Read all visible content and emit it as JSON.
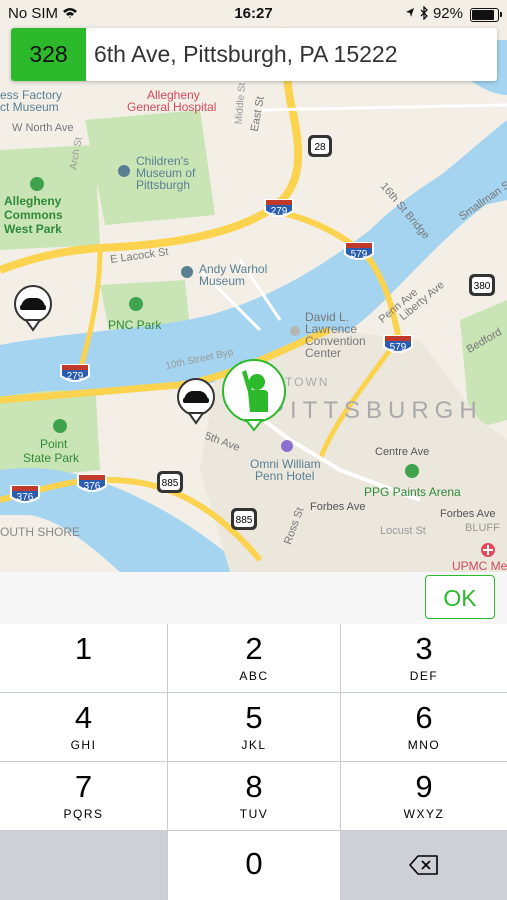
{
  "status_bar": {
    "carrier": "No SIM",
    "time": "16:27",
    "battery": "92%"
  },
  "address_bar": {
    "code": "328",
    "address": "6th Ave, Pittsburgh, PA 15222"
  },
  "map": {
    "labels": {
      "factory": "ess Factory",
      "factory2": "ct Museum",
      "allegheny_hospital": "Allegheny",
      "allegheny_hospital2": "General Hospital",
      "north_ave": "W North Ave",
      "childrens": "Children's",
      "childrens2": "Museum of",
      "childrens3": "Pittsburgh",
      "commons": "Allegheny",
      "commons2": "Commons",
      "commons3": "West Park",
      "lacock": "E Lacock St",
      "warhol": "Andy Warhol",
      "warhol2": "Museum",
      "pnc": "PNC Park",
      "david": "David L.",
      "david2": "Lawrence",
      "david3": "Convention",
      "david4": "Center",
      "penn": "Penn Ave",
      "liberty": "Liberty Ave",
      "tenth": "10th Street Byp",
      "fifth": "5th Ave",
      "omni": "Omni William",
      "omni2": "Penn Hotel",
      "point": "Point",
      "point2": "State Park",
      "centre": "Centre Ave",
      "ppg": "PPG Paints Arena",
      "forbes": "Forbes Ave",
      "forbes2": "Forbes Ave",
      "locust": "Locust St",
      "bluff": "BLUFF",
      "upmc": "UPMC Me",
      "shore": "OUTH SHORE",
      "downtown": "PITTSBURGH",
      "bridge16": "16th St Bridge",
      "wbridge": "Smallman S",
      "bedford": "Bedford",
      "ross": "Ross St",
      "east": "East St",
      "wood": "Wood",
      "arch": "Arch St",
      "middle": "Middle St",
      "sandusky": "Sandusky St",
      "towntxt": "TOWN"
    },
    "shields": {
      "i279a": "279",
      "i579a": "579",
      "i579b": "579",
      "i279b": "279",
      "i376a": "376",
      "i376b": "376",
      "us28": "28",
      "us380": "380",
      "us885a": "885",
      "us885b": "885"
    }
  },
  "ok_button": {
    "label": "OK"
  },
  "keypad": {
    "keys": [
      {
        "num": "1",
        "letters": ""
      },
      {
        "num": "2",
        "letters": "ABC"
      },
      {
        "num": "3",
        "letters": "DEF"
      },
      {
        "num": "4",
        "letters": "GHI"
      },
      {
        "num": "5",
        "letters": "JKL"
      },
      {
        "num": "6",
        "letters": "MNO"
      },
      {
        "num": "7",
        "letters": "PQRS"
      },
      {
        "num": "8",
        "letters": "TUV"
      },
      {
        "num": "9",
        "letters": "WXYZ"
      },
      {
        "num": "0",
        "letters": ""
      }
    ]
  },
  "colors": {
    "accent": "#2cb92c",
    "water": "#a4d4f0",
    "land": "#f3efe7",
    "park": "#c8e6b4",
    "road": "#fbd34e"
  }
}
